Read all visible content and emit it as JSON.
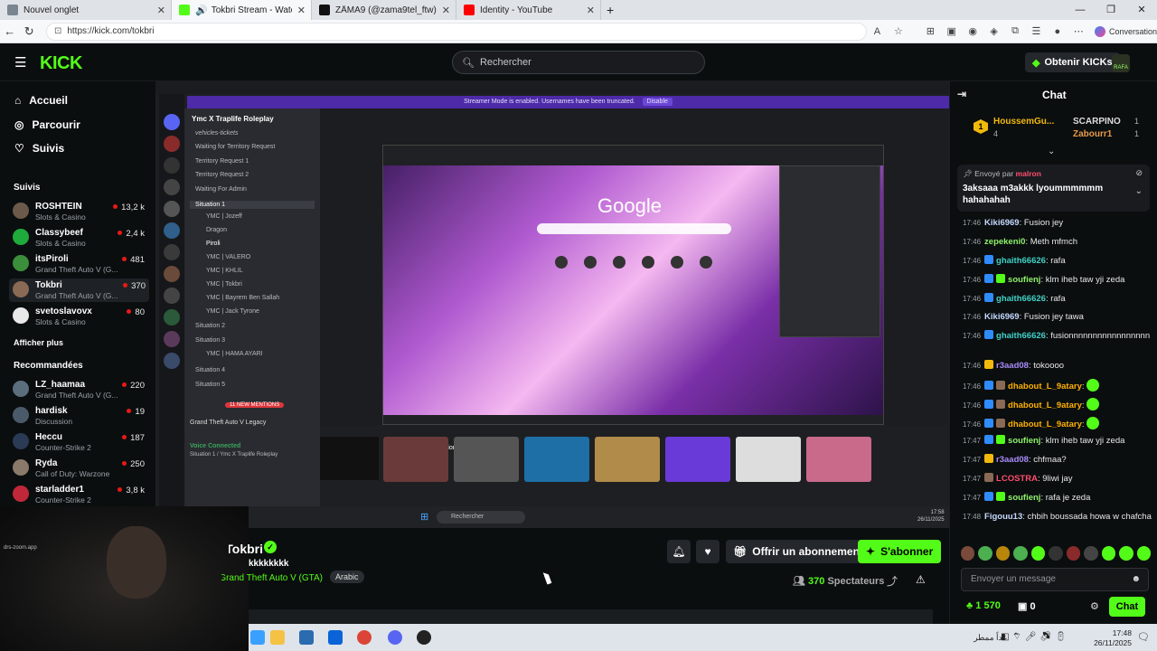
{
  "browser": {
    "tabs": [
      {
        "label": "Nouvel onglet",
        "color": "#7a8591"
      },
      {
        "label": "Tokbri Stream - Watch Live o",
        "color": "#53fc18",
        "active": true
      },
      {
        "label": "ZÅMA9 (@zama9tel_ftw) | TikTo",
        "color": "#111111"
      },
      {
        "label": "Identity - YouTube",
        "color": "#ff0000"
      }
    ],
    "new_tab": "+",
    "url": "https://kick.com/tokbri",
    "conversation_label": "Conversation"
  },
  "header": {
    "logo": "KICK",
    "search_placeholder": "Rechercher",
    "kicks_button": "Obtenir KICKs",
    "avatar_label": "RAFA"
  },
  "sidebar": {
    "nav": [
      "Accueil",
      "Parcourir",
      "Suivis"
    ],
    "following_title": "Suivis",
    "following": [
      {
        "name": "ROSHTEIN",
        "category": "Slots & Casino",
        "viewers": "13,2 k",
        "color": "#6b5a4a"
      },
      {
        "name": "Classybeef",
        "category": "Slots & Casino",
        "viewers": "2,4 k",
        "color": "#1faa3c"
      },
      {
        "name": "itsPiroli",
        "category": "Grand Theft Auto V (G...",
        "viewers": "481",
        "color": "#3b8f3b"
      },
      {
        "name": "Tokbri",
        "category": "Grand Theft Auto V (G...",
        "viewers": "370",
        "color": "#8a6a55"
      },
      {
        "name": "svetoslavovx",
        "category": "Slots & Casino",
        "viewers": "80",
        "color": "#e8e8e8"
      }
    ],
    "show_more": "Afficher plus",
    "recommended_title": "Recommandées",
    "recommended": [
      {
        "name": "LZ_haamaa",
        "category": "Grand Theft Auto V (G...",
        "viewers": "220",
        "color": "#5b6e7c"
      },
      {
        "name": "hardisk",
        "category": "Discussion",
        "viewers": "19",
        "color": "#4a5a6a"
      },
      {
        "name": "Heccu",
        "category": "Counter-Strike 2",
        "viewers": "187",
        "color": "#2b3a55"
      },
      {
        "name": "Ryda",
        "category": "Call of Duty: Warzone",
        "viewers": "250",
        "color": "#8a7a6a"
      },
      {
        "name": "starladder1",
        "category": "Counter-Strike 2",
        "viewers": "3,8 k",
        "color": "#c0283a"
      }
    ]
  },
  "player": {
    "streamer_mode": "Streamer Mode is enabled. Usernames have been truncated.",
    "streamer_mode_btn": "Disable",
    "server_name": "Ymc X Traplife Roleplay",
    "channels": [
      "vehicles-tickets",
      "Waiting for Territory Request",
      "Territory Request 1",
      "Territory Request 2",
      "Waiting For Admin",
      "Situation 1",
      "Situation 2",
      "Situation 3",
      "Situation 4",
      "Situation 5"
    ],
    "members": [
      "YMC | Jozeff",
      "Dragon",
      "Piroli",
      "YMC | VALERO",
      "YMC | KHLIL",
      "YMC | Tokbri",
      "YMC | Bayrem Ben Sallah",
      "YMC | Jack Tyrone",
      "YMC | HAMA AYARI"
    ],
    "new_mentions": "11 NEW MENTIONS",
    "game_activity": "Grand Theft Auto V Legacy",
    "voice_connected": "Voice Connected",
    "voice_channel": "Situation 1 / Ymc X Traplife Roleplay",
    "google_logo": "Google",
    "options_label": "Options",
    "taskbar_search": "Rechercher",
    "inner_time": "17:58",
    "inner_date": "26/11/2025"
  },
  "webcam": {
    "label": "drs-zoom.app"
  },
  "stream": {
    "name": "Tokbri",
    "title": "kkkkkkkk",
    "category": "Grand Theft Auto V (GTA)",
    "tag": "Arabic",
    "gift_label": "Offrir un abonnement",
    "subscribe_label": "S'abonner",
    "viewers": "370",
    "viewers_label": "Spectateurs"
  },
  "chat": {
    "title": "Chat",
    "leaders": [
      {
        "name": "HoussemGu...",
        "count": "4",
        "rank": "1"
      },
      {
        "name": "SCARPINO",
        "count": "1",
        "rank": "2"
      },
      {
        "name": "Zabourr1",
        "count": "1",
        "rank": "3"
      }
    ],
    "pinned_label": "Envoyé par",
    "pinned_user": "malron",
    "pinned_text": "3aksaaa m3akkk lyoummmmmm hahahahah",
    "messages": [
      {
        "time": "17:46",
        "user": "Kiki6969",
        "color": "#c5d8ff",
        "text": "Fusion jey",
        "badges": []
      },
      {
        "time": "17:46",
        "user": "zepekeni0",
        "color": "#8ef26b",
        "text": "Meth mfmch",
        "badges": []
      },
      {
        "time": "17:46",
        "user": "ghaith66626",
        "color": "#3fd2c7",
        "text": "rafa",
        "badges": [
          "#2f8cff"
        ]
      },
      {
        "time": "17:46",
        "user": "soufienj",
        "color": "#8ef26b",
        "text": "klm iheb taw yji zeda",
        "badges": [
          "#2f8cff",
          "#53fc18"
        ]
      },
      {
        "time": "17:46",
        "user": "ghaith66626",
        "color": "#3fd2c7",
        "text": "rafa",
        "badges": [
          "#2f8cff"
        ]
      },
      {
        "time": "17:46",
        "user": "Kiki6969",
        "color": "#c5d8ff",
        "text": "Fusion jey tawa",
        "badges": []
      },
      {
        "time": "17:46",
        "user": "ghaith66626",
        "color": "#3fd2c7",
        "text": "fusionnnnnnnnnnnnnnnnn",
        "badges": [
          "#2f8cff"
        ]
      },
      {
        "time": "17:46",
        "user": "r3aad08",
        "color": "#a78bfa",
        "text": "tokoooo",
        "badges": [
          "#f0b90b"
        ]
      },
      {
        "time": "17:46",
        "user": "dhabout_L_9atary",
        "color": "#ffb000",
        "text": "",
        "badges": [
          "#2f8cff",
          "#8a6a55"
        ]
      },
      {
        "time": "17:46",
        "user": "dhabout_L_9atary",
        "color": "#ffb000",
        "text": "",
        "badges": [
          "#2f8cff",
          "#8a6a55"
        ]
      },
      {
        "time": "17:46",
        "user": "dhabout_L_9atary",
        "color": "#ffb000",
        "text": "",
        "badges": [
          "#2f8cff",
          "#8a6a55"
        ]
      },
      {
        "time": "17:47",
        "user": "soufienj",
        "color": "#8ef26b",
        "text": "klm iheb taw yji zeda",
        "badges": [
          "#2f8cff",
          "#53fc18"
        ]
      },
      {
        "time": "17:47",
        "user": "r3aad08",
        "color": "#a78bfa",
        "text": "chfmaa?",
        "badges": [
          "#f0b90b"
        ]
      },
      {
        "time": "17:47",
        "user": "LCOSTRA",
        "color": "#ff4d6d",
        "text": "9liwi jay",
        "badges": [
          "#8a6a55"
        ]
      },
      {
        "time": "17:47",
        "user": "soufienj",
        "color": "#8ef26b",
        "text": "rafa je zeda",
        "badges": [
          "#2f8cff",
          "#53fc18"
        ]
      },
      {
        "time": "17:48",
        "user": "Figouu13",
        "color": "#c5d8ff",
        "text": "chbih boussada howa w chafcha",
        "badges": []
      }
    ],
    "input_placeholder": "Envoyer un message",
    "kicks_count": "1 570",
    "gifts_count": "0",
    "send_label": "Chat"
  },
  "taskbar": {
    "weather": "غداً ممطر",
    "time": "17:48",
    "date": "26/11/2025"
  }
}
